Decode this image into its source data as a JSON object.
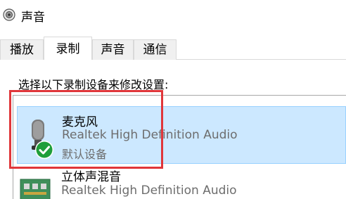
{
  "window": {
    "title": "声音",
    "icon": "speaker-icon"
  },
  "tabs": [
    {
      "label": "播放",
      "active": false
    },
    {
      "label": "录制",
      "active": true
    },
    {
      "label": "声音",
      "active": false
    },
    {
      "label": "通信",
      "active": false
    }
  ],
  "recording": {
    "instruction": "选择以下录制设备来修改设置:",
    "devices": [
      {
        "name": "麦克风",
        "driver": "Realtek High Definition Audio",
        "status": "默认设备",
        "icon": "microphone-icon",
        "badge_icon": "default-device-check-icon",
        "selected": true
      },
      {
        "name": "立体声混音",
        "driver": "Realtek High Definition Audio",
        "icon": "sound-card-icon",
        "selected": false
      }
    ]
  },
  "annotation": {
    "highlight_color": "#e0363a"
  },
  "colors": {
    "selection_bg": "#cce8ff",
    "selection_border": "#99d1ff",
    "default_badge": "#1f9e3a"
  }
}
